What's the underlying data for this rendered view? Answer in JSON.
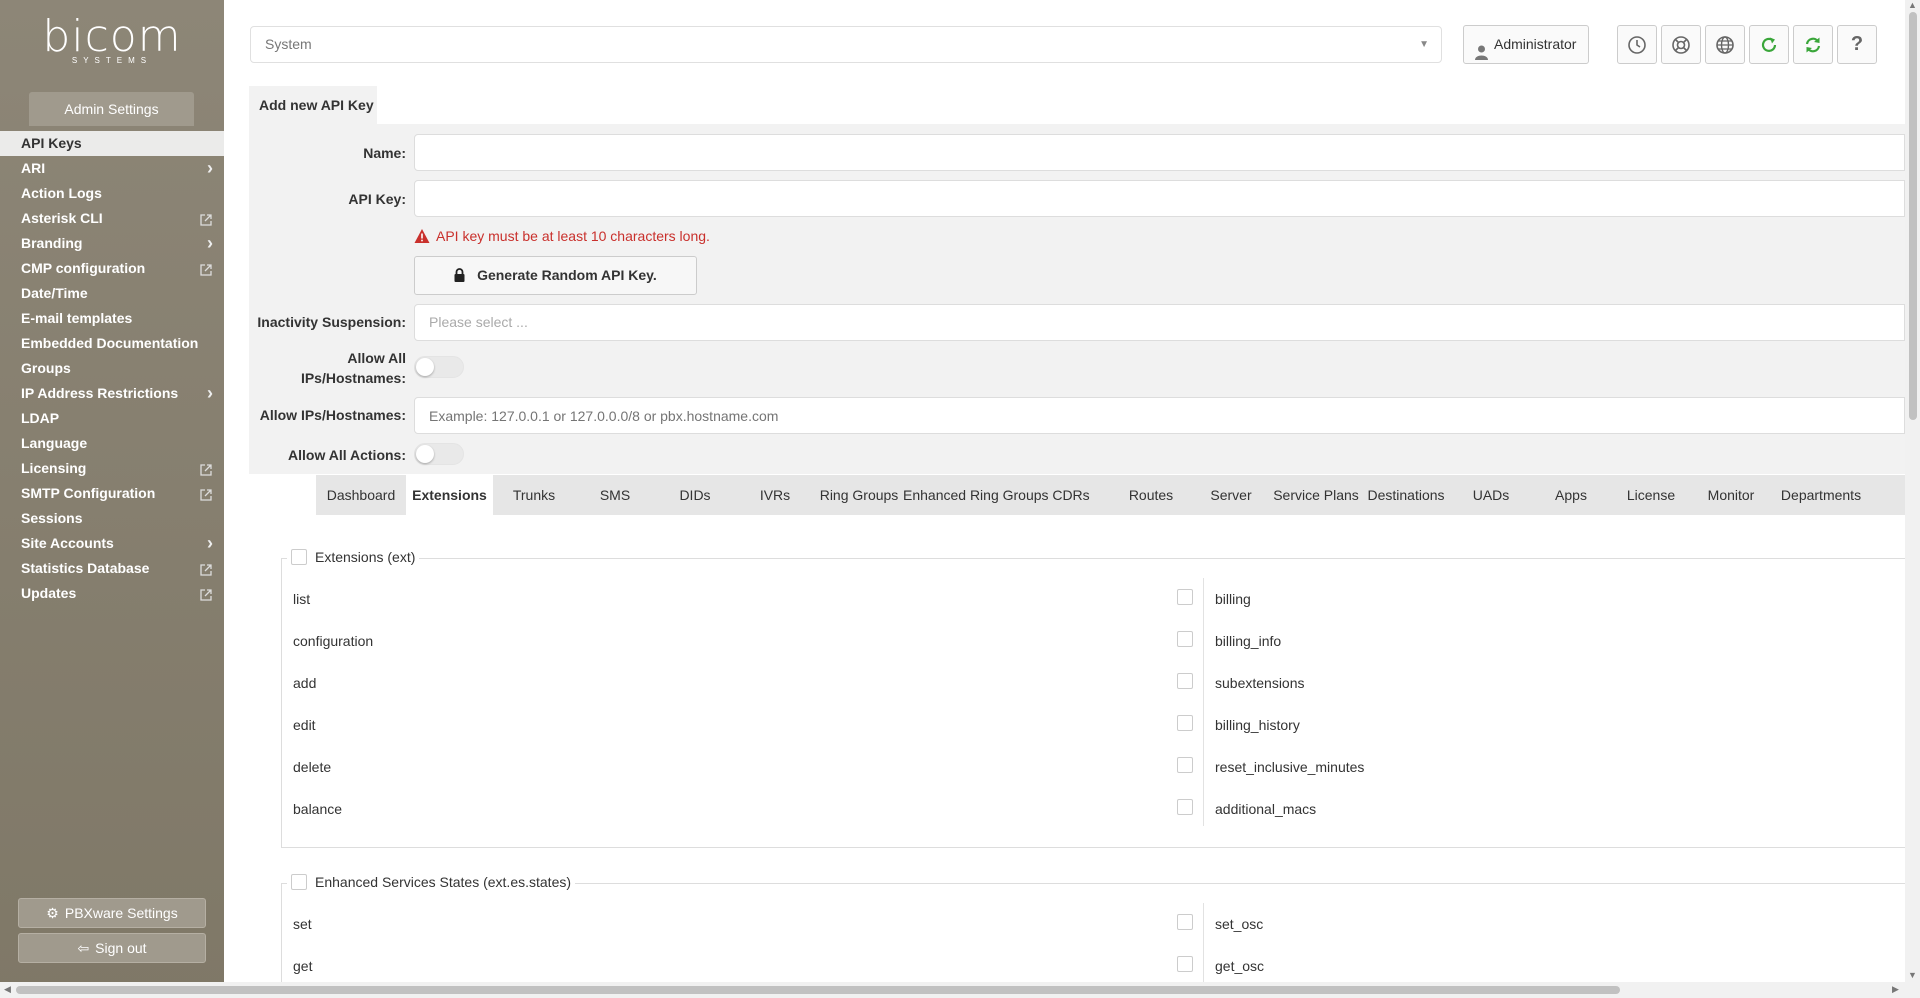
{
  "sidebar": {
    "logo_text": "bicom",
    "logo_sub": "SYSTEMS",
    "section_title": "Admin Settings",
    "items": [
      {
        "label": "API Keys",
        "active": true
      },
      {
        "label": "ARI",
        "chevron": true
      },
      {
        "label": "Action Logs"
      },
      {
        "label": "Asterisk CLI",
        "external": true
      },
      {
        "label": "Branding",
        "chevron": true
      },
      {
        "label": "CMP configuration",
        "external": true
      },
      {
        "label": "Date/Time"
      },
      {
        "label": "E-mail templates"
      },
      {
        "label": "Embedded Documentation"
      },
      {
        "label": "Groups"
      },
      {
        "label": "IP Address Restrictions",
        "chevron": true
      },
      {
        "label": "LDAP"
      },
      {
        "label": "Language"
      },
      {
        "label": "Licensing",
        "external": true
      },
      {
        "label": "SMTP Configuration",
        "external": true
      },
      {
        "label": "Sessions"
      },
      {
        "label": "Site Accounts",
        "chevron": true
      },
      {
        "label": "Statistics Database",
        "external": true
      },
      {
        "label": "Updates",
        "external": true
      }
    ],
    "pbxware_button": "PBXware Settings",
    "signout_button": "Sign out"
  },
  "topbar": {
    "system_select": "System",
    "user_button": "Administrator",
    "icons": [
      "clock-icon",
      "support-icon",
      "globe-icon",
      "refresh-icon",
      "sync-icon",
      "help-icon"
    ],
    "accent_green": "#3aa63a"
  },
  "form": {
    "tab_title": "Add new API Key",
    "name_label": "Name:",
    "name_value": "",
    "apikey_label": "API Key:",
    "apikey_value": "",
    "error_text": "API key must be at least 10 characters long.",
    "error_color": "#c9302c",
    "generate_button": "Generate Random API Key.",
    "inactivity_label": "Inactivity Suspension:",
    "inactivity_placeholder": "Please select ...",
    "allow_all_ips_label_1": "Allow All",
    "allow_all_ips_label_2": "IPs/Hostnames:",
    "allow_all_ips_on": false,
    "allow_ips_label": "Allow IPs/Hostnames:",
    "allow_ips_placeholder": "Example: 127.0.0.1 or 127.0.0.0/8 or pbx.hostname.com",
    "allow_all_actions_label": "Allow All Actions:",
    "allow_all_actions_on": false
  },
  "permission_tabs": [
    {
      "label": "Dashboard",
      "w": 90
    },
    {
      "label": "Extensions",
      "w": 87,
      "active": true
    },
    {
      "label": "Trunks",
      "w": 82
    },
    {
      "label": "SMS",
      "w": 80
    },
    {
      "label": "DIDs",
      "w": 80
    },
    {
      "label": "IVRs",
      "w": 80
    },
    {
      "label": "Ring Groups",
      "w": 88
    },
    {
      "label": "Enhanced Ring Groups",
      "w": 128
    },
    {
      "label": "CDRs",
      "w": 80
    },
    {
      "label": "Routes",
      "w": 80
    },
    {
      "label": "Server",
      "w": 80
    },
    {
      "label": "Service Plans",
      "w": 90
    },
    {
      "label": "Destinations",
      "w": 90
    },
    {
      "label": "UADs",
      "w": 80
    },
    {
      "label": "Apps",
      "w": 80
    },
    {
      "label": "License",
      "w": 80
    },
    {
      "label": "Monitor",
      "w": 80
    },
    {
      "label": "Departments",
      "w": 100
    }
  ],
  "groups": [
    {
      "title": "Extensions (ext)",
      "left": [
        "list",
        "configuration",
        "add",
        "edit",
        "delete",
        "balance"
      ],
      "right": [
        "billing",
        "billing_info",
        "subextensions",
        "billing_history",
        "reset_inclusive_minutes",
        "additional_macs"
      ]
    },
    {
      "title": "Enhanced Services States (ext.es.states)",
      "left": [
        "set",
        "get"
      ],
      "right": [
        "set_osc",
        "get_osc"
      ]
    }
  ]
}
